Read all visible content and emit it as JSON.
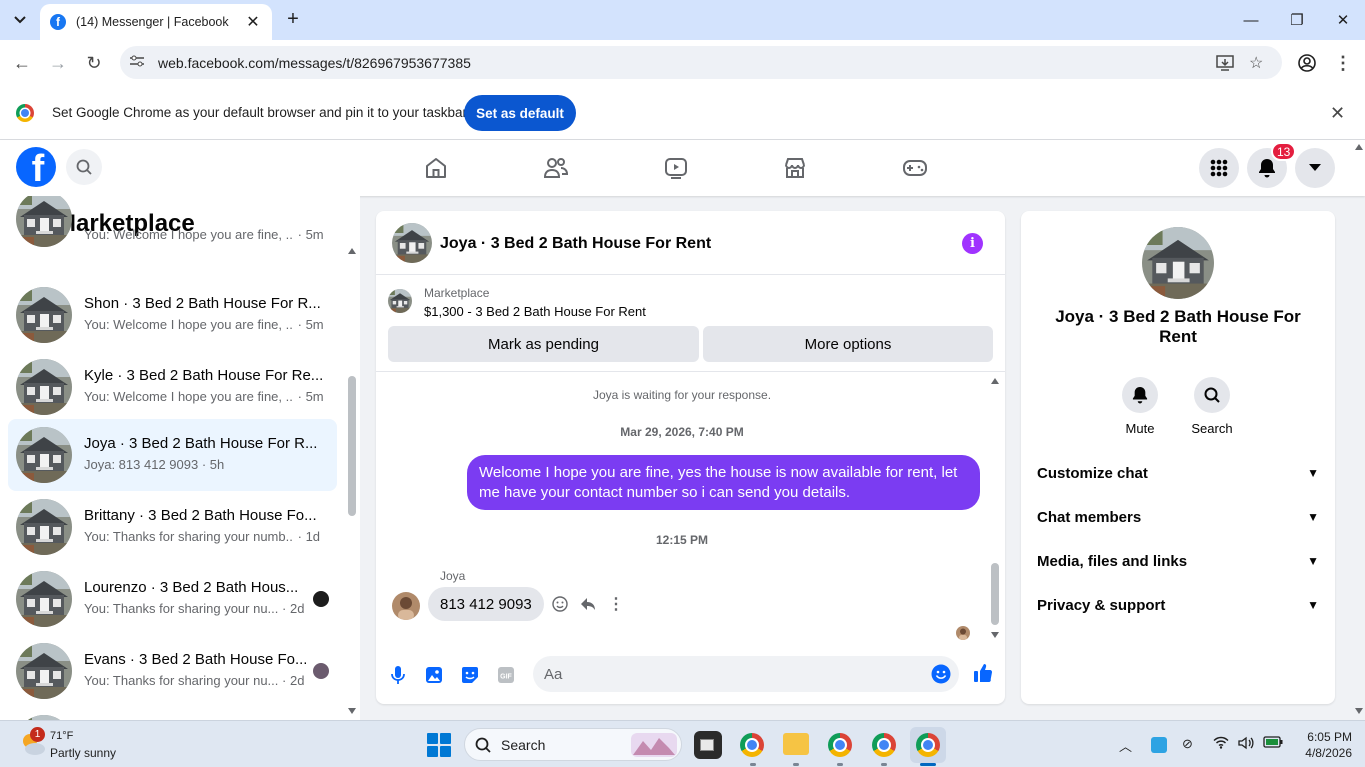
{
  "browser": {
    "tab_title": "(14) Messenger | Facebook",
    "url": "web.facebook.com/messages/t/826967953677385",
    "banner_text": "Set Google Chrome as your default browser and pin it to your taskbar",
    "banner_button": "Set as default"
  },
  "fb_header": {
    "notification_count": "13",
    "accent": "#0866ff"
  },
  "sidebar": {
    "title": "Marketplace",
    "conversations": [
      {
        "name": "",
        "snippet": "You: Welcome I hope you are fine, ...",
        "time": "5m"
      },
      {
        "name": "Shon · 3 Bed 2 Bath House For R...",
        "snippet": "You: Welcome I hope you are fine, ...",
        "time": "5m"
      },
      {
        "name": "Kyle · 3 Bed 2 Bath House For Re...",
        "snippet": "You: Welcome I hope you are fine, ...",
        "time": "5m"
      },
      {
        "name": "Joya · 3 Bed 2 Bath House For R...",
        "snippet": "Joya: 813 412 9093",
        "time": "5h"
      },
      {
        "name": "Brittany · 3 Bed 2 Bath House Fo...",
        "snippet": "You: Thanks for sharing your numb...",
        "time": "1d"
      },
      {
        "name": "Lourenzo · 3 Bed 2 Bath Hous...",
        "snippet": "You: Thanks for sharing your nu...",
        "time": "2d"
      },
      {
        "name": "Evans · 3 Bed 2 Bath House Fo...",
        "snippet": "You: Thanks for sharing your nu...",
        "time": "2d"
      }
    ]
  },
  "chat": {
    "title": "Joya · 3 Bed 2 Bath House For Rent",
    "listing_label": "Marketplace",
    "listing_price": "$1,300 - 3 Bed 2 Bath House For Rent",
    "mark_pending": "Mark as pending",
    "more_options": "More options",
    "waiting_notice": "Joya is waiting for your response.",
    "timestamp1": "Mar 29, 2026, 7:40 PM",
    "outgoing_message": "Welcome I hope you are fine, yes the house is now available for rent, let me have your contact number so i can send you  details.",
    "timestamp2": "12:15 PM",
    "incoming_sender": "Joya",
    "incoming_message": "813 412 9093",
    "composer_placeholder": "Aa",
    "outgoing_color": "#7b3cf2"
  },
  "info_panel": {
    "name": "Joya · 3 Bed 2 Bath House For Rent",
    "mute": "Mute",
    "search": "Search",
    "sections": [
      "Customize chat",
      "Chat members",
      "Media, files and links",
      "Privacy & support"
    ]
  },
  "taskbar": {
    "weather_temp": "71°F",
    "weather_desc": "Partly sunny",
    "weather_badge": "1",
    "search": "Search",
    "time": "6:05 PM",
    "date": "4/8/2026"
  }
}
